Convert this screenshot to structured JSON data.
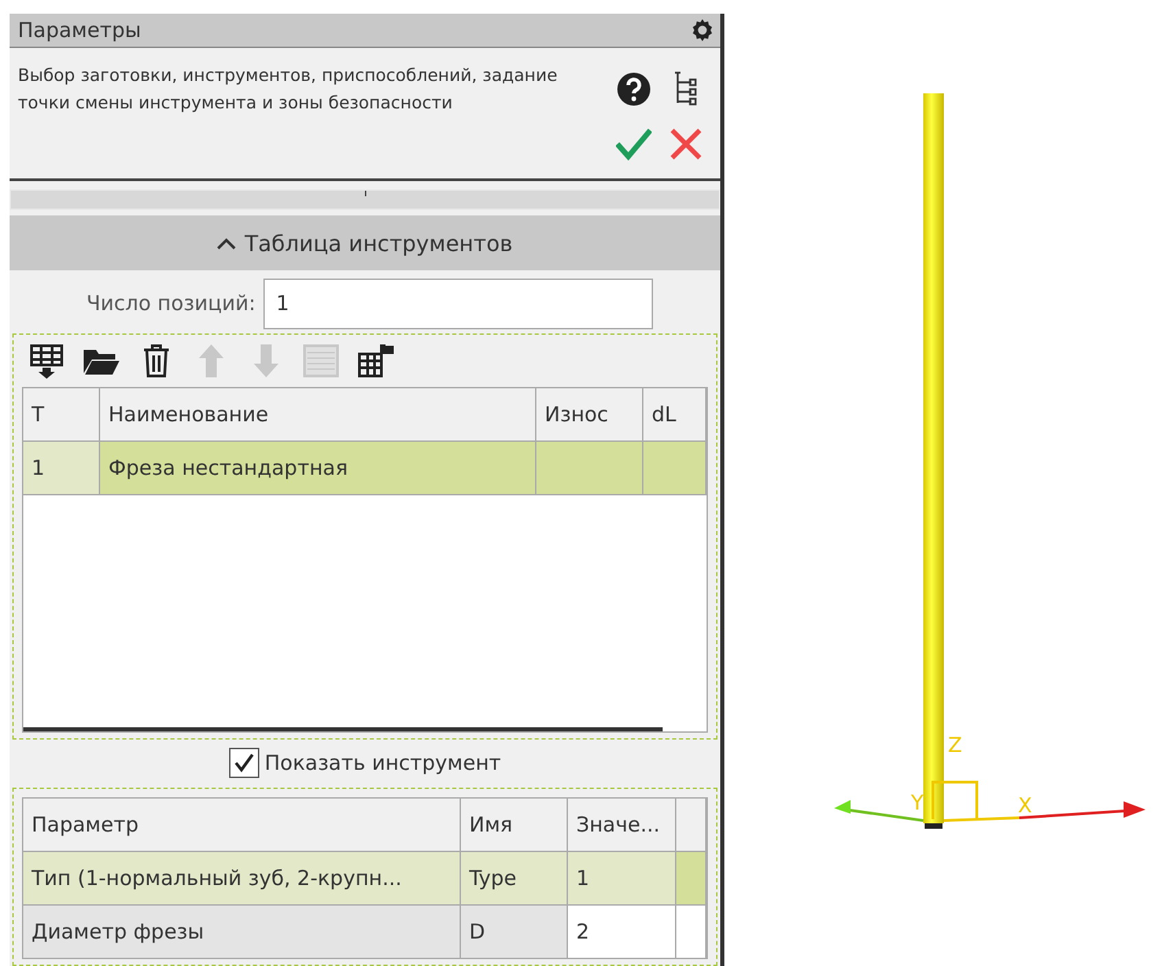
{
  "panel": {
    "title": "Параметры",
    "description": "Выбор заготовки, инструментов, приспособлений, задание точки смены инструмента и зоны безопасности"
  },
  "section": {
    "title": "Таблица инструментов",
    "expanded": true
  },
  "positions": {
    "label": "Число позиций:",
    "value": "1"
  },
  "toolbar": [
    {
      "kind": "insert",
      "disabled": false
    },
    {
      "kind": "open",
      "disabled": false
    },
    {
      "kind": "delete",
      "disabled": false
    },
    {
      "kind": "up",
      "disabled": true
    },
    {
      "kind": "down",
      "disabled": true
    },
    {
      "kind": "list",
      "disabled": true
    },
    {
      "kind": "table",
      "disabled": false
    }
  ],
  "tools": {
    "columns": [
      "T",
      "Наименование",
      "Износ",
      "dL"
    ],
    "rows": [
      {
        "cells": [
          "1",
          "Фреза нестандартная",
          "",
          ""
        ],
        "selected": true
      }
    ]
  },
  "show_tool": {
    "label": "Показать инструмент",
    "checked": true
  },
  "params": {
    "columns": [
      "Параметр",
      "Имя",
      "Значе..."
    ],
    "rows": [
      {
        "cells": [
          "Тип (1-нормальный зуб, 2-крупн...",
          "Type",
          "1"
        ],
        "selected": true
      },
      {
        "cells": [
          "Диаметр фрезы",
          "D",
          "2"
        ],
        "selected": false
      }
    ]
  },
  "viewport": {
    "axes": [
      {
        "kind": "z",
        "label": "Z"
      },
      {
        "kind": "y",
        "label": "Y"
      },
      {
        "kind": "x",
        "label": "X"
      }
    ]
  }
}
